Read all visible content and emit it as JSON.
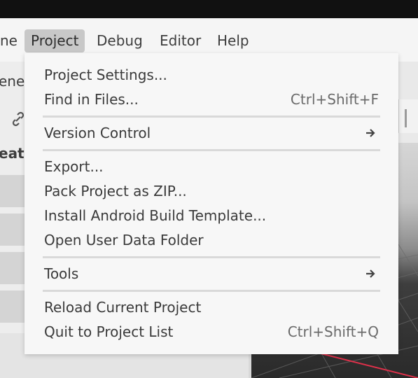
{
  "menubar": {
    "items": [
      {
        "label": "ne",
        "active": false
      },
      {
        "label": "Project",
        "active": true
      },
      {
        "label": "Debug",
        "active": false
      },
      {
        "label": "Editor",
        "active": false
      },
      {
        "label": "Help",
        "active": false
      }
    ]
  },
  "left_panel": {
    "partial_label_top": "ene",
    "partial_label_bold": "eate"
  },
  "project_menu": {
    "items": [
      {
        "label": "Project Settings...",
        "shortcut": ""
      },
      {
        "label": "Find in Files...",
        "shortcut": "Ctrl+Shift+F"
      },
      {
        "label": "Version Control",
        "submenu": true
      },
      {
        "label": "Export...",
        "shortcut": ""
      },
      {
        "label": "Pack Project as ZIP...",
        "shortcut": ""
      },
      {
        "label": "Install Android Build Template...",
        "shortcut": ""
      },
      {
        "label": "Open User Data Folder",
        "shortcut": ""
      },
      {
        "label": "Tools",
        "submenu": true
      },
      {
        "label": "Reload Current Project",
        "shortcut": ""
      },
      {
        "label": "Quit to Project List",
        "shortcut": "Ctrl+Shift+Q"
      }
    ]
  },
  "colors": {
    "titlebar": "#111111",
    "menubar_bg": "#f5f5f5",
    "active_menu_bg": "#c8c8c8",
    "popup_bg": "#f7f7f7",
    "grid_axis": "#e0304a"
  }
}
